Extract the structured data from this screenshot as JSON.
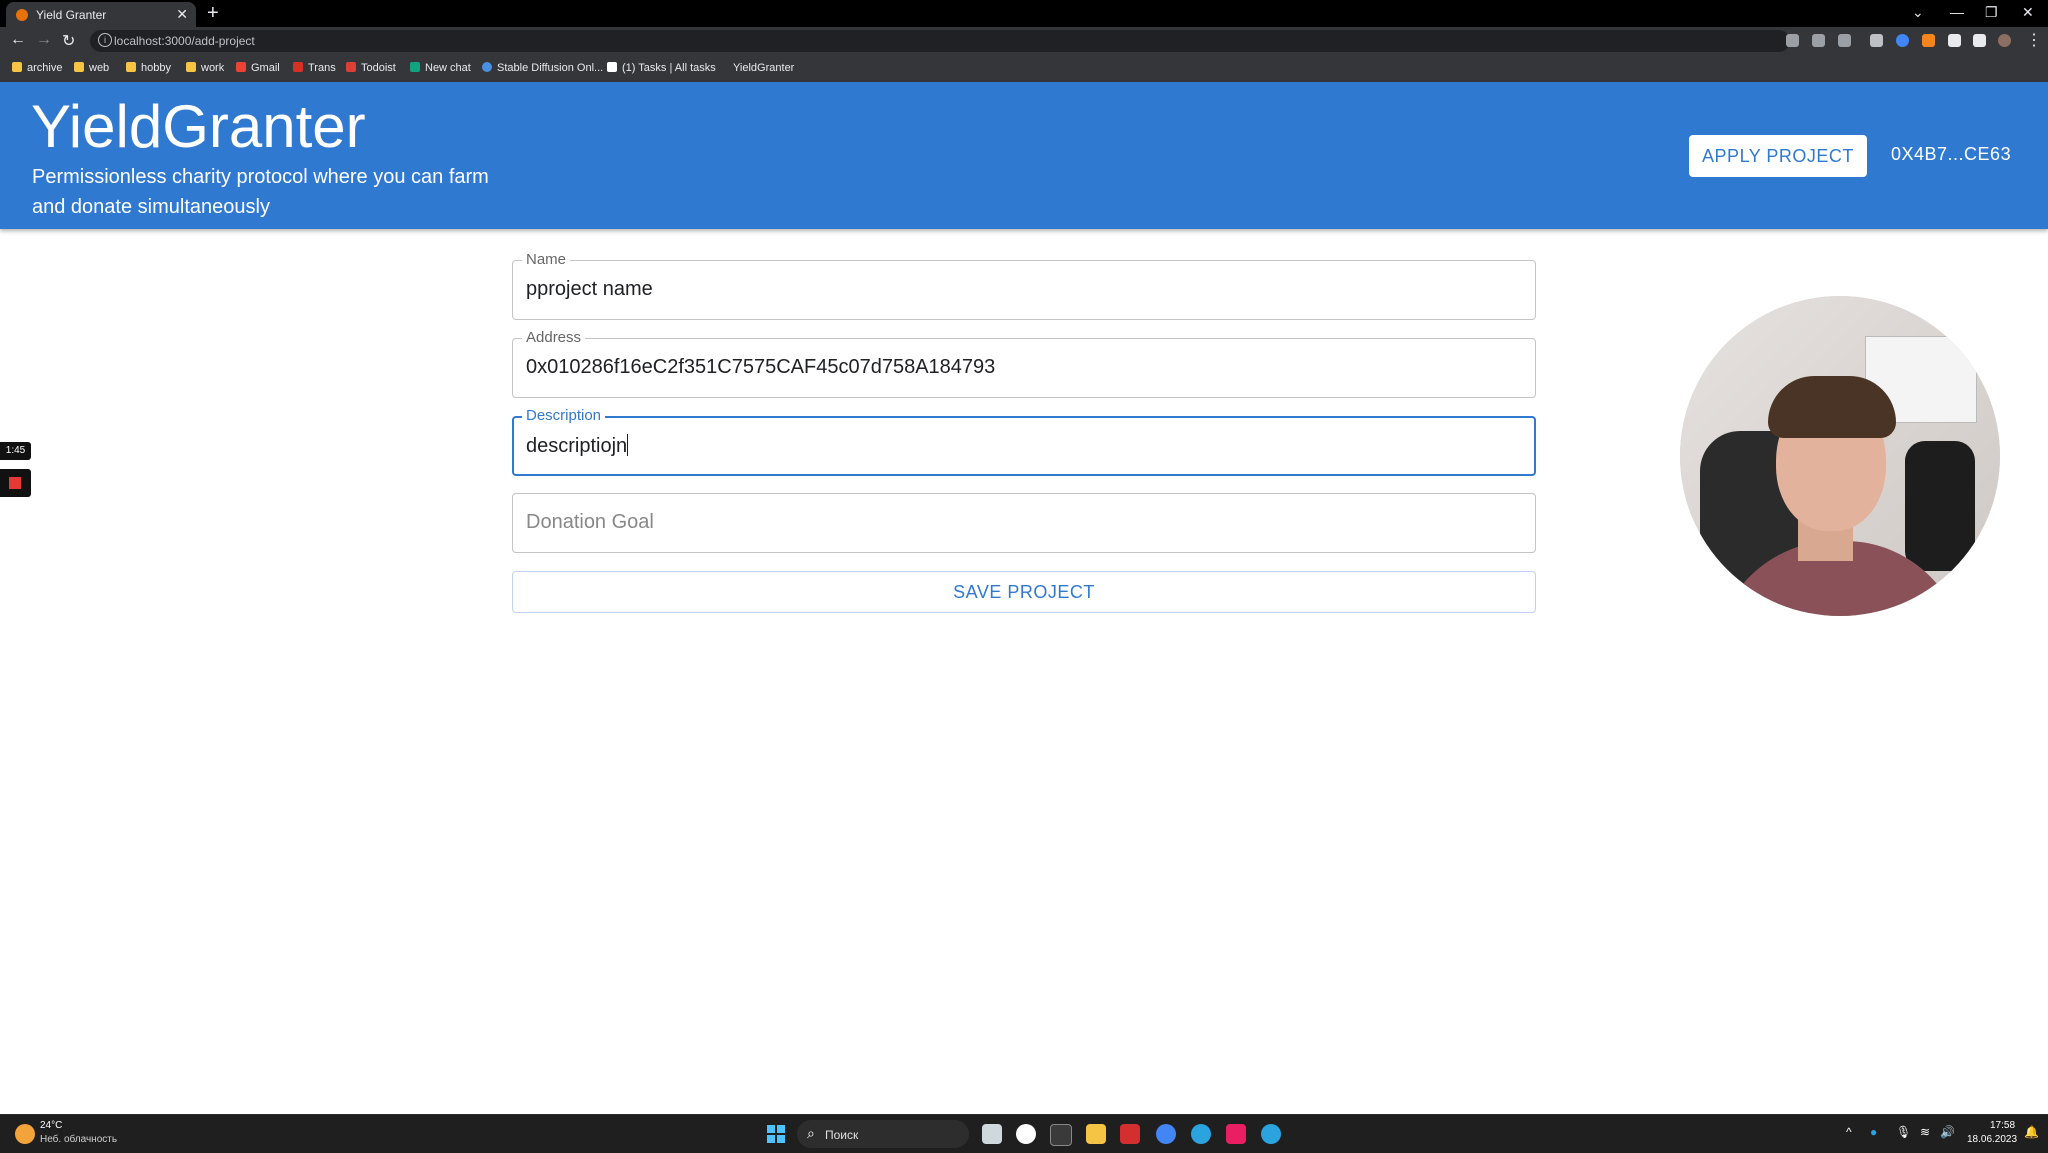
{
  "browser": {
    "tab_title": "Yield Granter",
    "tab_close": "✕",
    "new_tab": "+",
    "url": "localhost:3000/add-project",
    "win_minimize": "—",
    "win_restore": "❐",
    "win_close": "✕",
    "tab_search": "⌄",
    "nav": {
      "back": "←",
      "forward": "→",
      "reload": "↻"
    },
    "bookmarks": [
      {
        "label": "archive",
        "icon_color": "#f6c445"
      },
      {
        "label": "web",
        "icon_color": "#f6c445"
      },
      {
        "label": "hobby",
        "icon_color": "#f6c445"
      },
      {
        "label": "work",
        "icon_color": "#f6c445"
      },
      {
        "label": "Gmail",
        "icon_color": "#ea4335"
      },
      {
        "label": "Trans",
        "icon_color": "#d93025"
      },
      {
        "label": "Todoist",
        "icon_color": "#db4035"
      },
      {
        "label": "New chat",
        "icon_color": "#10a37f"
      },
      {
        "label": "Stable Diffusion Onl...",
        "icon_color": "#4a90e2"
      },
      {
        "label": "(1) Tasks | All tasks",
        "icon_color": "#ffffff"
      },
      {
        "label": "YieldGranter",
        "icon_color": "#35363a"
      }
    ]
  },
  "app": {
    "title": "YieldGranter",
    "subtitle": "Permissionless charity protocol where you can farm and donate simultaneously",
    "apply_button": "APPLY PROJECT",
    "account": "0X4B7...CE63",
    "brand_color": "#3079d1"
  },
  "form": {
    "name": {
      "label": "Name",
      "value": "pproject name"
    },
    "address": {
      "label": "Address",
      "value": "0x010286f16eC2f351C7575CAF45c07d758A184793"
    },
    "description": {
      "label": "Description",
      "value": "descriptiojn"
    },
    "donation_goal": {
      "placeholder": "Donation Goal"
    },
    "save_button": "SAVE PROJECT"
  },
  "recording": {
    "timer": "1:45"
  },
  "taskbar": {
    "weather_temp": "24°C",
    "weather_desc": "Неб. облачность",
    "search_placeholder": "Поиск",
    "time": "17:58",
    "date": "18.06.2023"
  }
}
